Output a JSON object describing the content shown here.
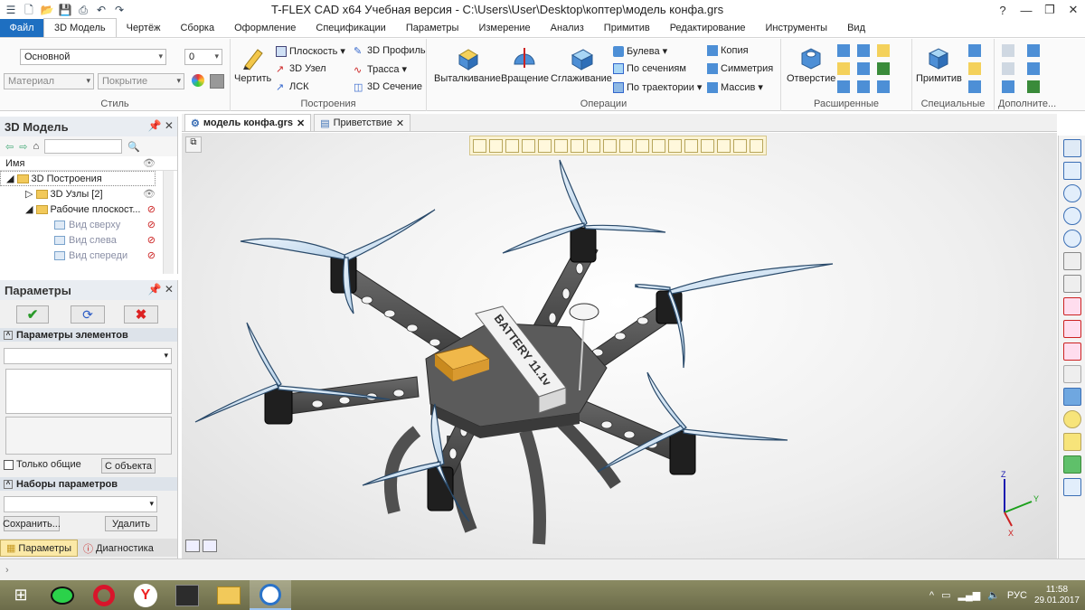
{
  "window": {
    "title": "T-FLEX CAD x64 Учебная версия - C:\\Users\\User\\Desktop\\коптер\\модель конфа.grs"
  },
  "menu": {
    "file": "Файл",
    "tabs": [
      "3D Модель",
      "Чертёж",
      "Сборка",
      "Оформление",
      "Спецификации",
      "Параметры",
      "Измерение",
      "Анализ",
      "Примитив",
      "Редактирование",
      "Инструменты",
      "Вид"
    ]
  },
  "ribbon": {
    "style": {
      "label": "Стиль",
      "style_value": "Основной",
      "num_value": "0",
      "material": "Материал",
      "coating": "Покрытие"
    },
    "build": {
      "label": "Построения",
      "draw": "Чертить",
      "plane": "Плоскость",
      "node": "3D Узел",
      "lsk": "ЛСК",
      "profile": "3D Профиль",
      "path": "Трасса",
      "section": "3D Сечение"
    },
    "ops": {
      "label": "Операции",
      "extrude": "Выталкивание",
      "rotate": "Вращение",
      "smooth": "Сглаживание",
      "boolean": "Булева",
      "bysections": "По сечениям",
      "bypath": "По траектории",
      "copy": "Копия",
      "symmetry": "Симметрия",
      "array": "Массив"
    },
    "ext": {
      "label": "Расширенные",
      "hole": "Отверстие"
    },
    "spec": {
      "label": "Специальные",
      "prim": "Примитив"
    },
    "more": {
      "label": "Дополните..."
    }
  },
  "model_panel": {
    "title": "3D Модель",
    "col_name": "Имя",
    "items": [
      {
        "label": "3D Построения"
      },
      {
        "label": "3D Узлы [2]"
      },
      {
        "label": "Рабочие плоскост..."
      },
      {
        "label": "Вид сверху"
      },
      {
        "label": "Вид слева"
      },
      {
        "label": "Вид спереди"
      }
    ]
  },
  "params_panel": {
    "title": "Параметры",
    "section1": "Параметры элементов",
    "only_common": "Только общие",
    "from_object": "С объекта",
    "section2": "Наборы параметров",
    "save": "Сохранить...",
    "delete": "Удалить",
    "tab_params": "Параметры",
    "tab_diag": "Диагностика"
  },
  "doc_tabs": [
    {
      "label": "модель конфа.grs"
    },
    {
      "label": "Приветствие"
    }
  ],
  "model": {
    "battery_text": "BATTERY 11.1v"
  },
  "axes": {
    "x": "X",
    "y": "Y",
    "z": "Z"
  },
  "tray": {
    "lang": "РУС",
    "time": "11:58",
    "date": "29.01.2017"
  }
}
